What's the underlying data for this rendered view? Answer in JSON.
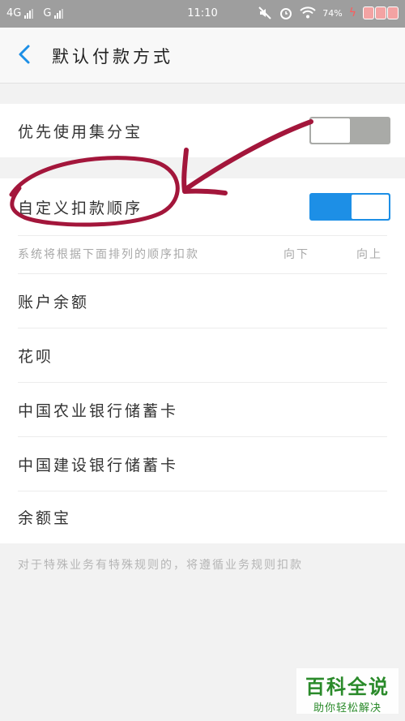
{
  "status_bar": {
    "network_1": "4G",
    "network_2": "G",
    "time": "11:10",
    "battery": "74%"
  },
  "header": {
    "title": "默认付款方式"
  },
  "settings": {
    "prefer_jifenbao": {
      "label": "优先使用集分宝",
      "enabled": false
    },
    "custom_order": {
      "label": "自定义扣款顺序",
      "enabled": true
    }
  },
  "order_hint": {
    "text": "系统将根据下面排列的顺序扣款",
    "move_down": "向下",
    "move_up": "向上"
  },
  "payment_methods": [
    {
      "label": "账户余额"
    },
    {
      "label": "花呗"
    },
    {
      "label": "中国农业银行储蓄卡"
    },
    {
      "label": "中国建设银行储蓄卡"
    },
    {
      "label": "余额宝"
    }
  ],
  "footer_note": "对于特殊业务有特殊规则的，将遵循业务规则扣款",
  "watermark": {
    "main": "百科全说",
    "sub": "助你轻松解决"
  },
  "colors": {
    "status_bar": "#9e9e9e",
    "accent": "#1d8fe6",
    "annotation": "#a3163b",
    "watermark": "#2a8a2a"
  }
}
